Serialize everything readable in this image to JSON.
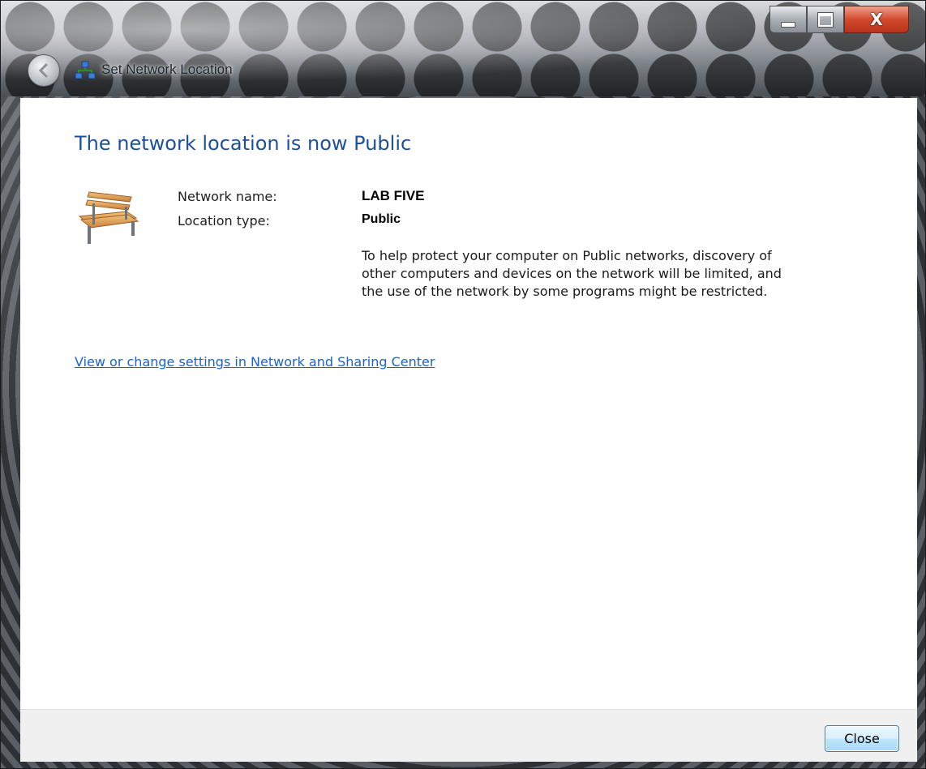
{
  "window": {
    "title": "Set Network Location",
    "caption_buttons": {
      "minimize_icon": "minimize-icon",
      "maximize_icon": "maximize-icon",
      "close_glyph": "X"
    },
    "colors": {
      "heading": "#1f4f9c",
      "link": "#1a64c8",
      "close_caption": "#d24a2d"
    }
  },
  "main": {
    "heading": "The network location is now Public",
    "icon": "park-bench-icon",
    "network_name_label": "Network name:",
    "network_name_value": "LAB FIVE",
    "location_type_label": "Location type:",
    "location_type_value": "Public",
    "description": "To help protect your computer on Public networks, discovery of other computers and devices on the network will be limited, and the use of the network by some programs might be restricted.",
    "settings_link": "View or change settings in Network and Sharing Center"
  },
  "footer": {
    "close_label": "Close"
  }
}
